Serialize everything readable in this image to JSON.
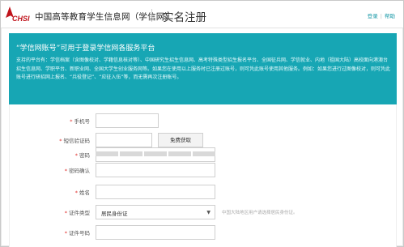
{
  "header": {
    "logo_text": "CHSI",
    "site_title": "中国高等教育学生信息网（学信网）",
    "page_title": "实名注册",
    "login_link": "登录",
    "separator": "|",
    "help_link": "帮助"
  },
  "banner": {
    "title": "“学信网账号”可用于登录学信网各服务平台",
    "body": "支持的平台有：学信档案（含图像校对、学籍信息核对等）、中国研究生招生信息网、高考特殊类型招生报名平台、全国征兵网、学信就业、内地（祖国大陆）高校面向港澳台招生信息网、学职平台、新职业网、全国大学生创业服务网等。如果您在使用以上服务时已注册过账号，则可凭此账号使用其他服务。例如：如果您进行过图像校对，则可凭此账号进行研招网上报名、“兵役登记”、“应征入伍”等，而无需再次注册账号。"
  },
  "form": {
    "phone_label": "手机号",
    "sms_label": "短信验证码",
    "sms_button": "免费获取",
    "password_label": "密码",
    "password_confirm_label": "密码确认",
    "name_label": "姓名",
    "id_type_label": "证件类型",
    "id_type_value": "居民身份证",
    "id_type_hint": "中国大陆地区用户请选择居民身份证。",
    "id_number_label": "证件号码"
  },
  "colors": {
    "brand_red": "#c0141c",
    "banner_teal": "#17a6b4",
    "required_red": "#e0312e"
  }
}
